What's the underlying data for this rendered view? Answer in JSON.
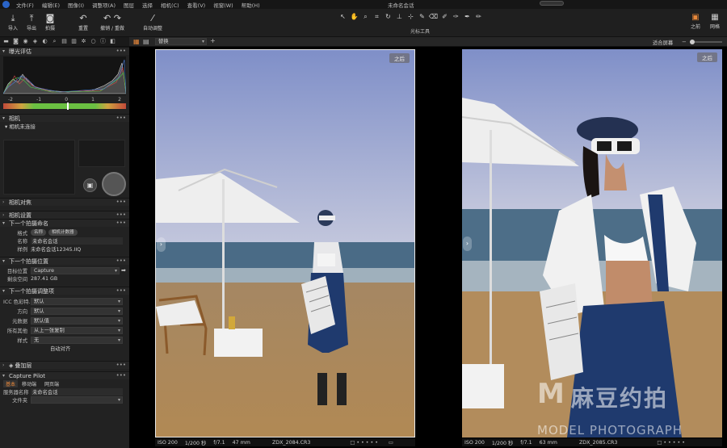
{
  "menubar": {
    "items": [
      "文件(F)",
      "编辑(E)",
      "图像(I)",
      "调整项(A)",
      "图层",
      "选择",
      "相机(C)",
      "查看(V)",
      "视窗(W)",
      "帮助(H)"
    ],
    "window_title": "未命名会话"
  },
  "toolbar": {
    "import": "导入",
    "export": "导出",
    "capture": "拍摄",
    "reset": "重置",
    "undo_redo": "撤销 / 重做",
    "auto_adjust": "自动调整",
    "cursor_tools_label": "光标工具",
    "before": "之前",
    "grid": "网格"
  },
  "viewbar": {
    "view_select": "替换",
    "fit_screen": "适合屏幕"
  },
  "panel": {
    "exposure": {
      "title": "曝光评估",
      "scale": [
        "-2",
        "-1",
        "0",
        "1",
        "2"
      ]
    },
    "camera": {
      "title": "相机",
      "not_connected": "相机未连接"
    },
    "camera_focus": {
      "title": "相机对焦"
    },
    "camera_settings": {
      "title": "相机设置"
    },
    "next_naming": {
      "title": "下一个拍摄命名",
      "format_label": "格式",
      "format_tokens": [
        "名称",
        "相机计数器"
      ],
      "name_label": "名称",
      "name_value": "未命名会话",
      "sample_label": "样例",
      "sample_value": "未命名会话12345.IIQ"
    },
    "next_location": {
      "title": "下一个拍摄位置",
      "dest_label": "目标位置",
      "dest_value": "Capture",
      "free_label": "剩余空间",
      "free_value": "287.41 GB"
    },
    "next_adjust": {
      "title": "下一个拍摄调整项",
      "rows": [
        {
          "label": "ICC 色彩特...",
          "value": "默认"
        },
        {
          "label": "方向",
          "value": "默认"
        },
        {
          "label": "元数据",
          "value": "默认值"
        },
        {
          "label": "所有其他",
          "value": "从上一张复制"
        },
        {
          "label": "样式",
          "value": "无"
        }
      ],
      "auto_align": "自动对齐"
    },
    "overlay": {
      "title": "叠加层"
    },
    "capture_pilot": {
      "title": "Capture Pilot",
      "tabs": [
        "基本",
        "移动端",
        "网页端"
      ],
      "server_label": "服务器名称",
      "server_value": "未命名会话",
      "folder_label": "文件夹"
    }
  },
  "viewer": {
    "left": {
      "badge": "之后",
      "iso": "ISO 200",
      "shutter": "1/200 秒",
      "aperture": "f/7.1",
      "focal": "47 mm",
      "filename": "ZDX_2084.CR3"
    },
    "right": {
      "badge": "之后",
      "iso": "ISO 200",
      "shutter": "1/200 秒",
      "aperture": "f/7.1",
      "focal": "63 mm",
      "filename": "ZDX_2085.CR3"
    }
  },
  "watermark": {
    "cn": "麻豆约拍",
    "en": "MODEL PHOTOGRAPH"
  },
  "colors": {
    "accent": "#e7873a",
    "sky": "#9aa8d2",
    "sand": "#b48a5a",
    "denim": "#1f3a6e"
  }
}
